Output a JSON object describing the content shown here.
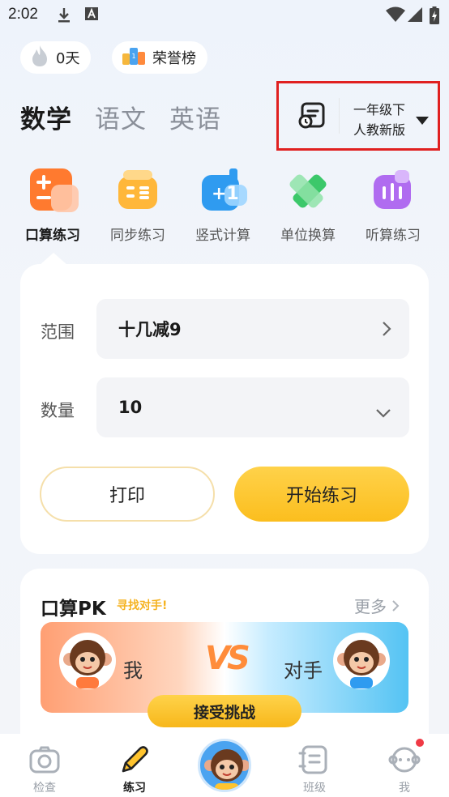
{
  "status_bar": {
    "time": "2:02"
  },
  "top_pills": {
    "streak_label": "0天",
    "honor_label": "荣誉榜"
  },
  "subjects": [
    "数学",
    "语文",
    "英语"
  ],
  "grade": {
    "line1": "一年级下",
    "line2": "人教新版"
  },
  "features": [
    "口算练习",
    "同步练习",
    "竖式计算",
    "单位换算",
    "听算练习"
  ],
  "practice": {
    "range_label": "范围",
    "range_value": "十几减9",
    "count_label": "数量",
    "count_value": "10",
    "print_label": "打印",
    "start_label": "开始练习"
  },
  "pk": {
    "title": "口算PK",
    "subtitle": "寻找对手!",
    "more_label": "更多",
    "me_label": "我",
    "vs_label": "VS",
    "opponent_label": "对手",
    "accept_label": "接受挑战"
  },
  "bottom_nav": [
    "检查",
    "练习",
    "班级",
    "我"
  ],
  "colors": {
    "accent_yellow": "#fbbe1e",
    "highlight_red": "#e02020"
  }
}
